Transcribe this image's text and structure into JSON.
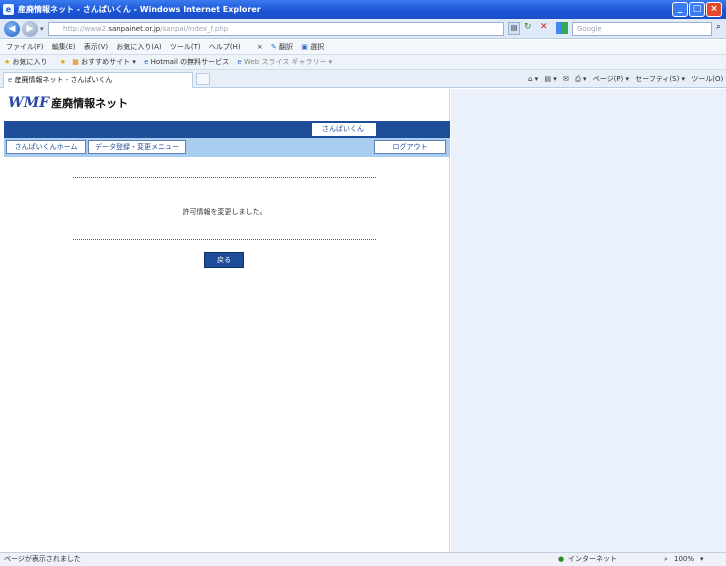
{
  "window": {
    "title": "産廃情報ネット - さんぱいくん - Windows Internet Explorer",
    "min": "_",
    "max": "□",
    "close": "×"
  },
  "address": {
    "prefix": "http://www2.",
    "domain": "sanpainet.or.jp",
    "path": "/sanpai/index_f.php",
    "search_placeholder": "Google"
  },
  "menu": {
    "items": [
      "ファイル(F)",
      "編集(E)",
      "表示(V)",
      "お気に入り(A)",
      "ツール(T)",
      "ヘルプ(H)"
    ],
    "translate": "翻訳",
    "select": "選択"
  },
  "favorites": {
    "label": "お気に入り",
    "items": [
      "おすすめサイト ▾",
      "Hotmail の無料サービス",
      "Web スライス ギャラリー ▾"
    ]
  },
  "tab": {
    "title": "産廃情報ネット - さんぱいくん"
  },
  "commands": {
    "items": [
      "ページ(P) ▾",
      "セーフティ(S) ▾",
      "ツール(O) ▾"
    ]
  },
  "site": {
    "logo_mark": "WMF",
    "logo_name": "産廃情報ネット",
    "user_label": "さんぱいくん",
    "nav": {
      "home": "さんぱいくんホーム",
      "data_menu": "データ登録・変更メニュー",
      "logout": "ログアウト"
    },
    "message": "許可情報を変更しました。",
    "back_button": "戻る"
  },
  "status": {
    "text": "ページが表示されました",
    "zone": "インターネット",
    "zoom": "100%"
  }
}
